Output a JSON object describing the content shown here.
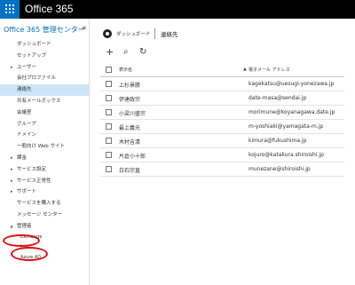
{
  "app": {
    "name": "Office 365"
  },
  "sidebar": {
    "title": "Office 365 管理センター",
    "collapse_glyph": "«",
    "items": [
      {
        "label": "ダッシュボード"
      },
      {
        "label": "セットアップ"
      },
      {
        "label": "ユーザー",
        "expandable": true
      },
      {
        "label": "会社プロファイル"
      },
      {
        "label": "連絡先",
        "selected": true
      },
      {
        "label": "共有メールボックス"
      },
      {
        "label": "会議室"
      },
      {
        "label": "グループ"
      },
      {
        "label": "ドメイン"
      },
      {
        "label": "一般向け Web サイト"
      },
      {
        "label": "課金",
        "expandable": true
      },
      {
        "label": "サービス設定",
        "expandable": true
      },
      {
        "label": "サービス正常性",
        "expandable": true
      },
      {
        "label": "サポート",
        "expandable": true
      },
      {
        "label": "サービスを購入する"
      },
      {
        "label": "メッセージ センター"
      },
      {
        "label": "管理者",
        "expanded": true
      }
    ],
    "admin_children": [
      {
        "label": "Exchange"
      },
      {
        "label": "Lync"
      },
      {
        "label": "Azure AD"
      }
    ]
  },
  "breadcrumb": {
    "dashboard": "ダッシュボード",
    "current": "連絡先"
  },
  "toolbar": {
    "add_glyph": "+",
    "search_glyph": "⌕",
    "refresh_glyph": "↻"
  },
  "table": {
    "headers": {
      "name": "表示名",
      "sort": "▲",
      "email": "電子メール アドレス"
    },
    "rows": [
      {
        "name": "上杉景勝",
        "email": "kagekatsu@uesugi-yonezawa.jp"
      },
      {
        "name": "伊達政宗",
        "email": "date-masa@sendai.jp"
      },
      {
        "name": "小梁川盛宗",
        "email": "morimune@koyanagawa.date.jp"
      },
      {
        "name": "最上義光",
        "email": "m-yoshiaki@yamagata-m.jp"
      },
      {
        "name": "木村吉清",
        "email": "kimura@fukushima.jp"
      },
      {
        "name": "片倉小十郎",
        "email": "kojuro@katakura.shiroishi.jp"
      },
      {
        "name": "白石宗直",
        "email": "munezane@shiroishi.jp"
      }
    ]
  },
  "colors": {
    "accent": "#0072c6",
    "selected_bg": "#cde6f7",
    "highlight_ring": "#e01010"
  }
}
